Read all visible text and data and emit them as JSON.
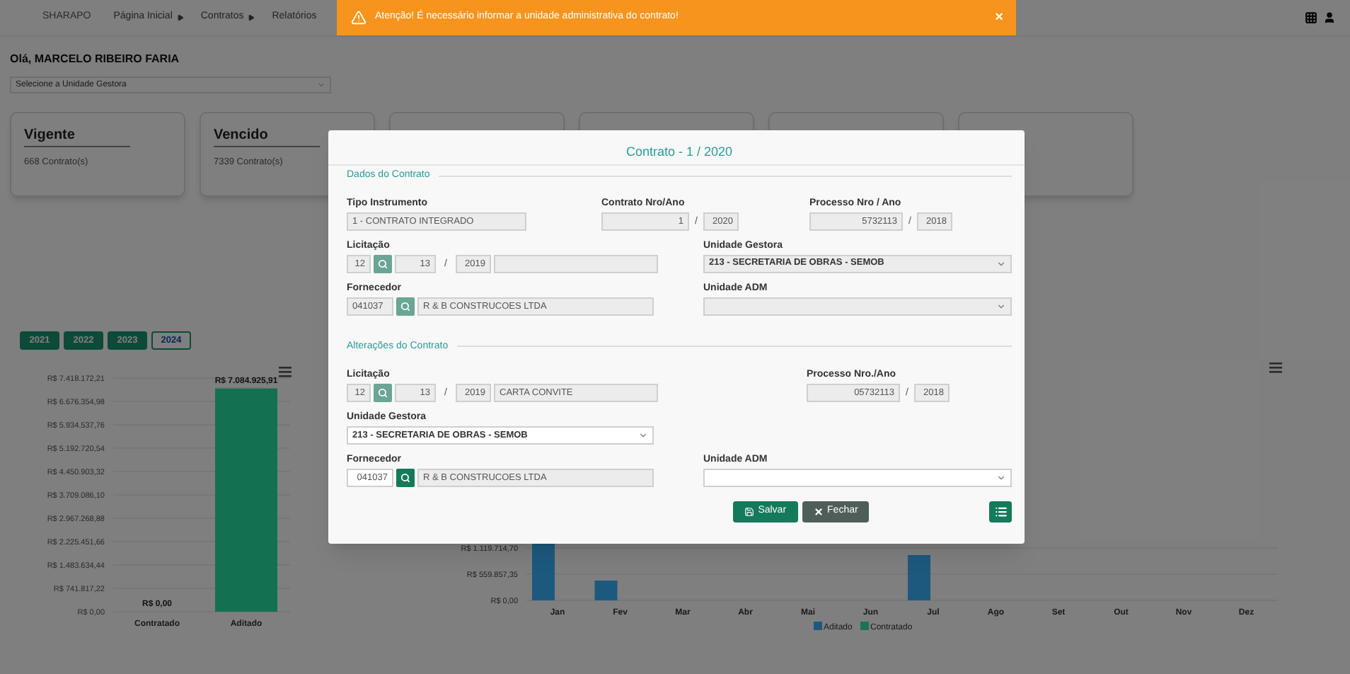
{
  "toast": {
    "message": "Atenção! É necessário informar a unidade administrativa do contrato!",
    "close": "×"
  },
  "header": {
    "logo": "SHARAPO",
    "nav": [
      {
        "label": "Página Inicial",
        "submenu": true
      },
      {
        "label": "Contratos",
        "submenu": true
      },
      {
        "label": "Relatórios",
        "submenu": false
      }
    ]
  },
  "greeting": "Olá, MARCELO RIBEIRO FARIA",
  "unit_select": {
    "placeholder": "Selecione a Unidade Gestora"
  },
  "status_cards": [
    {
      "title": "Vigente",
      "count": "668 Contrato(s)"
    },
    {
      "title": "Vencido",
      "count": "7339 Contrato(s)"
    }
  ],
  "years": [
    {
      "label": "2021",
      "selected": false
    },
    {
      "label": "2022",
      "selected": false
    },
    {
      "label": "2023",
      "selected": false
    },
    {
      "label": "2024",
      "selected": true
    }
  ],
  "totals_chart": {
    "y_axis_labels": [
      "R$ 7.418.172,21",
      "R$ 6.676.354,98",
      "R$ 5.934.537,76",
      "R$ 5.192.720,54",
      "R$ 4.450.903,32",
      "R$ 3.709.086,10",
      "R$ 2.967.268,88",
      "R$ 2.225.451,66",
      "R$ 1.483.634,44",
      "R$ 741.817,22",
      "R$ 0,00"
    ],
    "bars": [
      {
        "category": "Contratado",
        "value_label": "R$ 0,00"
      },
      {
        "category": "Aditado",
        "value_label": "R$ 7.084.925,91"
      }
    ]
  },
  "monthly_chart": {
    "y_axis_labels": [
      "R$ 1.119.714,70",
      "R$ 559.857,35",
      "R$ 0,00"
    ],
    "months": [
      "Jan",
      "Fev",
      "Mar",
      "Abr",
      "Mai",
      "Jun",
      "Jul",
      "Ago",
      "Set",
      "Out",
      "Nov",
      "Dez"
    ],
    "legend": [
      {
        "label": "Aditado"
      },
      {
        "label": "Contratado"
      }
    ]
  },
  "modal": {
    "title": "Contrato - 1 / 2020",
    "contract_data": {
      "heading": "Dados do Contrato",
      "tipo_instrumento": {
        "label": "Tipo Instrumento",
        "value": "1 - CONTRATO INTEGRADO",
        "disabled": true
      },
      "contrato_nro_ano": {
        "label": "Contrato Nro/Ano",
        "number": "1",
        "separator": "/",
        "year": "2020",
        "disabled": true
      },
      "processo_nro_ano": {
        "label": "Processo Nro / Ano",
        "number": "5732113",
        "separator": "/",
        "year": "2018",
        "disabled": true
      },
      "licitacao": {
        "label": "Licitação",
        "modality": "12",
        "number": "13",
        "separator": "/",
        "year": "2019",
        "disabled": true
      },
      "unidade_gestora": {
        "label": "Unidade Gestora",
        "value": "213 - SECRETARIA DE OBRAS - SEMOB",
        "disabled": true
      },
      "fornecedor": {
        "label": "Fornecedor",
        "code": "041037",
        "name": "R & B CONSTRUCOES LTDA",
        "disabled": true
      },
      "unidade_adm": {
        "label": "Unidade ADM",
        "disabled": true
      }
    },
    "amendments": {
      "heading": "Alterações do Contrato",
      "licitacao": {
        "label": "Licitação",
        "modality": "12",
        "number": "13",
        "separator": "/",
        "year": "2019",
        "description": "CARTA CONVITE",
        "disabled": true
      },
      "processo_nro_ano": {
        "label": "Processo Nro./Ano",
        "number": "05732113",
        "separator": "/",
        "year": "2018",
        "disabled": true
      },
      "unidade_gestora": {
        "label": "Unidade Gestora",
        "value": "213 - SECRETARIA DE OBRAS - SEMOB",
        "disabled": false
      },
      "fornecedor": {
        "label": "Fornecedor",
        "code": "041037",
        "name": "R & B CONSTRUCOES LTDA",
        "disabled": false
      },
      "unidade_adm": {
        "label": "Unidade ADM",
        "disabled": false
      }
    },
    "buttons": [
      {
        "kind": "save",
        "label": "Salvar"
      },
      {
        "kind": "close",
        "label": "Fechar"
      },
      {
        "kind": "list"
      }
    ]
  }
}
